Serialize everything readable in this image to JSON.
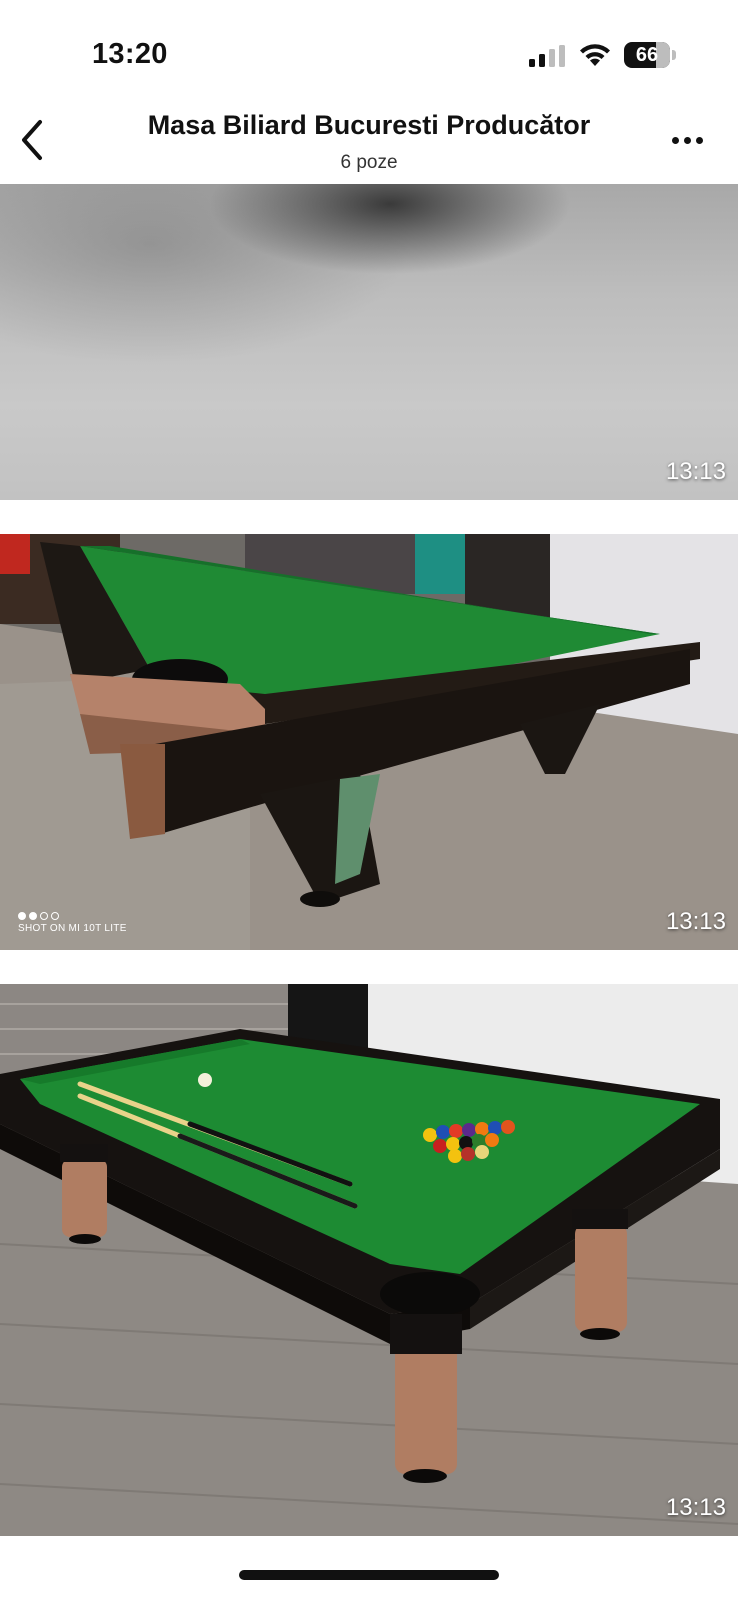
{
  "status_bar": {
    "time": "13:20",
    "battery_level": "66",
    "icons": [
      "signal-icon",
      "wifi-icon",
      "battery-icon"
    ]
  },
  "nav": {
    "title": "Masa Biliard Bucuresti Producător",
    "subtitle": "6 poze",
    "back_icon": "chevron-left-icon",
    "more_icon": "more-horizontal-icon"
  },
  "photos": [
    {
      "timestamp": "13:13"
    },
    {
      "timestamp": "13:13",
      "watermark": "SHOT ON MI 10T LITE"
    },
    {
      "timestamp": "13:13"
    }
  ],
  "colors": {
    "felt_green": "#1e8a33",
    "rail_black": "#1a1410",
    "copper_corner": "#b07d62",
    "background": "#ffffff"
  }
}
